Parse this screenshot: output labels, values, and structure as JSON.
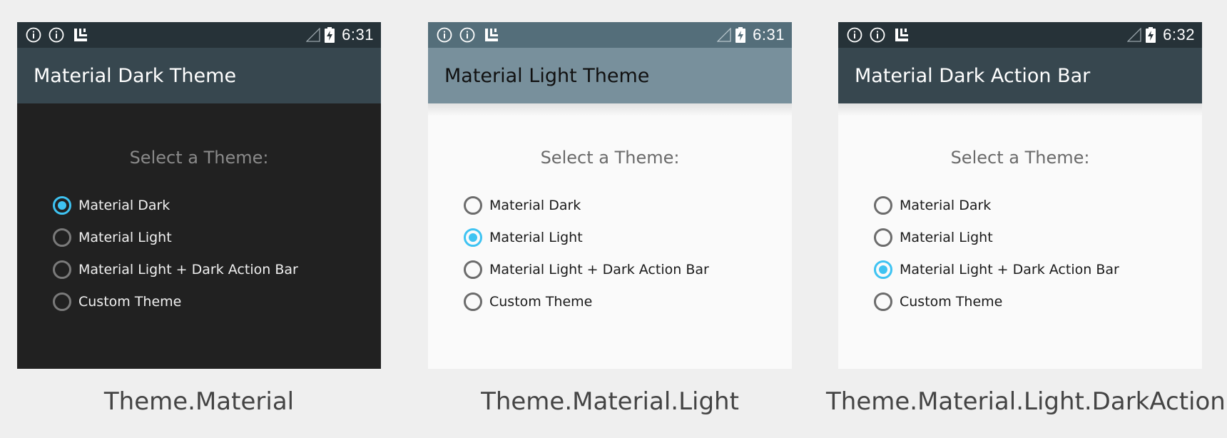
{
  "colors": {
    "page_background": "#efefef",
    "accent": "#3ec3f2",
    "dark_status_bar": "#263238",
    "dark_action_bar": "#37474f",
    "dark_content": "#212121",
    "light_status_bar": "#546e7a",
    "light_action_bar": "#78909c",
    "light_content": "#fafafa",
    "caption_text": "#444444"
  },
  "icons": {
    "status_left": [
      "info-icon",
      "info-icon",
      "app-launcher-icon"
    ],
    "status_right": [
      "signal-icon",
      "battery-charging-icon"
    ],
    "radio": "radio-button"
  },
  "prompt": "Select a Theme:",
  "options": [
    "Material Dark",
    "Material Light",
    "Material Light + Dark Action Bar",
    "Custom Theme"
  ],
  "screens": [
    {
      "time": "6:31",
      "title": "Material Dark Theme",
      "selected_option": "Material Dark",
      "caption": "Theme.Material"
    },
    {
      "time": "6:31",
      "title": "Material Light Theme",
      "selected_option": "Material Light",
      "caption": "Theme.Material.Light"
    },
    {
      "time": "6:32",
      "title": "Material Dark Action Bar",
      "selected_option": "Material Light + Dark Action Bar",
      "caption": "Theme.Material.Light.DarkActionBar"
    }
  ]
}
